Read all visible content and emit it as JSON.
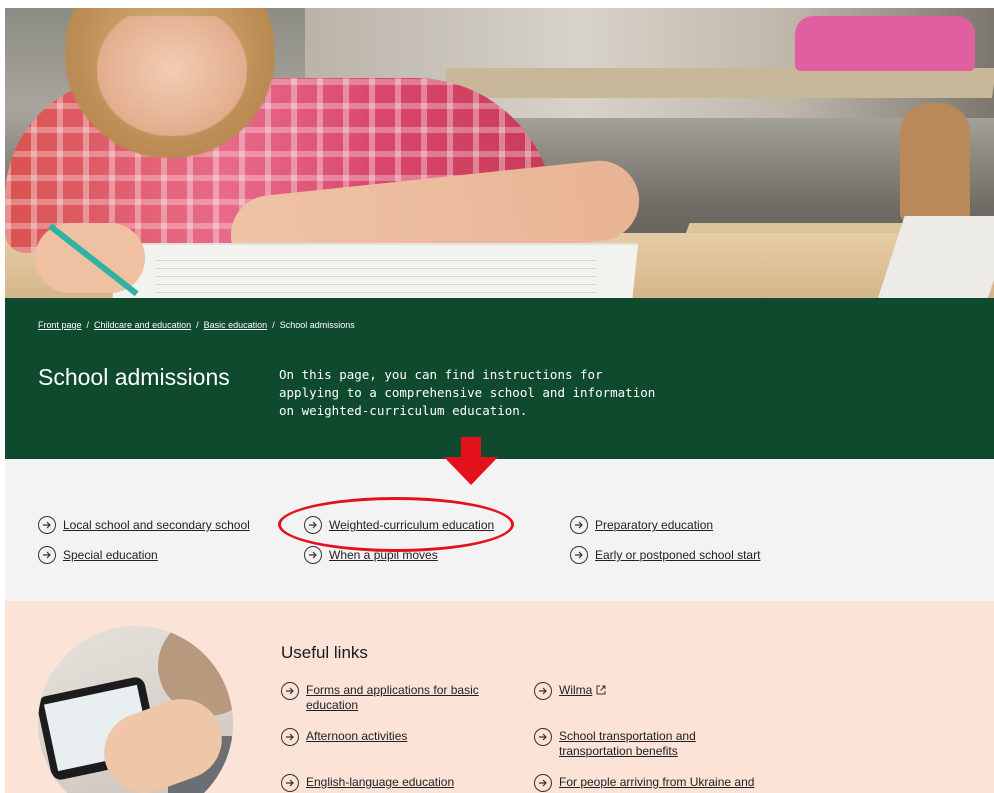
{
  "breadcrumb": {
    "items": [
      "Front page",
      "Childcare and education",
      "Basic education"
    ],
    "current": "School admissions",
    "separator": "/"
  },
  "intro": {
    "title": "School admissions",
    "text": "On this page, you can find instructions for applying to a comprehensive school and information on weighted-curriculum education."
  },
  "quick_links": [
    {
      "label": "Local school and secondary school"
    },
    {
      "label": "Special education"
    },
    {
      "label": "Weighted-curriculum education"
    },
    {
      "label": "When a pupil moves"
    },
    {
      "label": "Preparatory education"
    },
    {
      "label": "Early or postponed school start"
    }
  ],
  "useful_links": {
    "title": "Useful links",
    "items": [
      {
        "label": "Forms and applications for basic education"
      },
      {
        "label": "Afternoon activities"
      },
      {
        "label": "English-language education"
      },
      {
        "label": "Wilma"
      },
      {
        "label": "School transportation and transportation benefits"
      },
      {
        "label": "For people arriving from Ukraine and"
      }
    ]
  },
  "colors": {
    "intro_bg": "#0f4a2e",
    "quick_bg": "#f3f3f3",
    "useful_bg": "#fbe3d8",
    "annotation": "#e3121a"
  },
  "icons": {
    "link": "arrow-circle-right-icon",
    "external": "external-link-icon"
  }
}
